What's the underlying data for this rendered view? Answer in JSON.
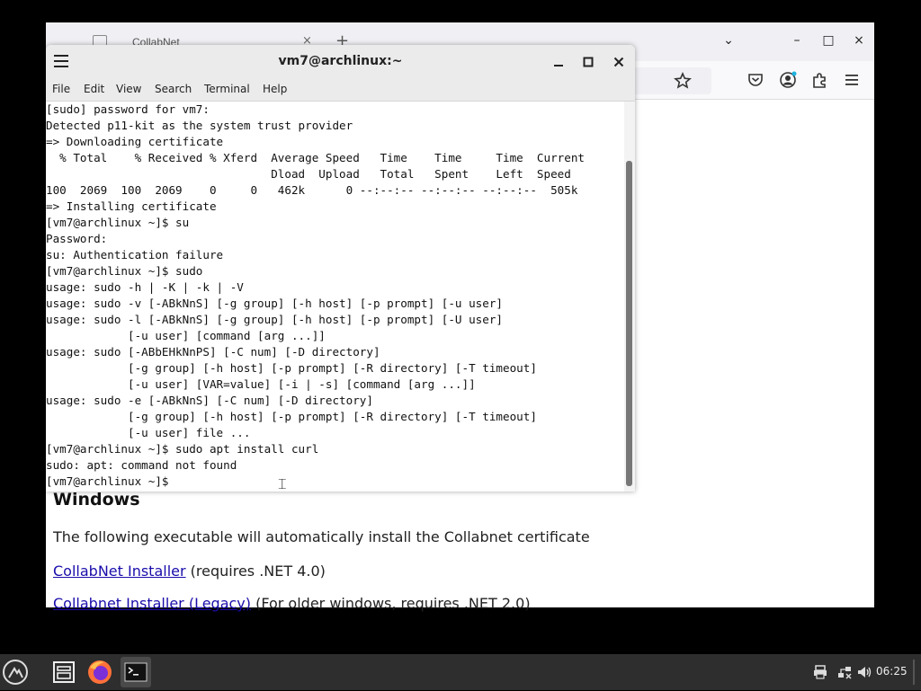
{
  "browser": {
    "tab": {
      "title": "CollabNet",
      "close": "×"
    },
    "new_tab": "+",
    "controls": {
      "list": "⌄",
      "minimize": "–",
      "maximize": "□",
      "close": "×"
    },
    "content": {
      "heading": "Windows",
      "paragraph": "The following executable will automatically install the Collabnet certificate",
      "links": [
        {
          "text": "CollabNet Installer",
          "suffix": " (requires .NET 4.0)"
        },
        {
          "text": "Collabnet Installer (Legacy)",
          "suffix": " (For older windows, requires .NET 2.0)"
        }
      ]
    }
  },
  "terminal": {
    "title": "vm7@archlinux:~",
    "menu": [
      "File",
      "Edit",
      "View",
      "Search",
      "Terminal",
      "Help"
    ],
    "lines": [
      "[sudo] password for vm7:",
      "Detected p11-kit as the system trust provider",
      "=> Downloading certificate",
      "  % Total    % Received % Xferd  Average Speed   Time    Time     Time  Current",
      "                                 Dload  Upload   Total   Spent    Left  Speed",
      "100  2069  100  2069    0     0   462k      0 --:--:-- --:--:-- --:--:--  505k",
      "=> Installing certificate",
      "[vm7@archlinux ~]$ su",
      "Password:",
      "su: Authentication failure",
      "[vm7@archlinux ~]$ sudo",
      "usage: sudo -h | -K | -k | -V",
      "usage: sudo -v [-ABkNnS] [-g group] [-h host] [-p prompt] [-u user]",
      "usage: sudo -l [-ABkNnS] [-g group] [-h host] [-p prompt] [-U user]",
      "            [-u user] [command [arg ...]]",
      "usage: sudo [-ABbEHkNnPS] [-C num] [-D directory]",
      "            [-g group] [-h host] [-p prompt] [-R directory] [-T timeout]",
      "            [-u user] [VAR=value] [-i | -s] [command [arg ...]]",
      "usage: sudo -e [-ABkNnS] [-C num] [-D directory]",
      "            [-g group] [-h host] [-p prompt] [-R directory] [-T timeout]",
      "            [-u user] file ...",
      "[vm7@archlinux ~]$ sudo apt install curl",
      "sudo: apt: command not found",
      "[vm7@archlinux ~]$ "
    ]
  },
  "taskbar": {
    "apps": [
      "file-manager",
      "firefox",
      "terminal"
    ],
    "clock": "06:25"
  }
}
